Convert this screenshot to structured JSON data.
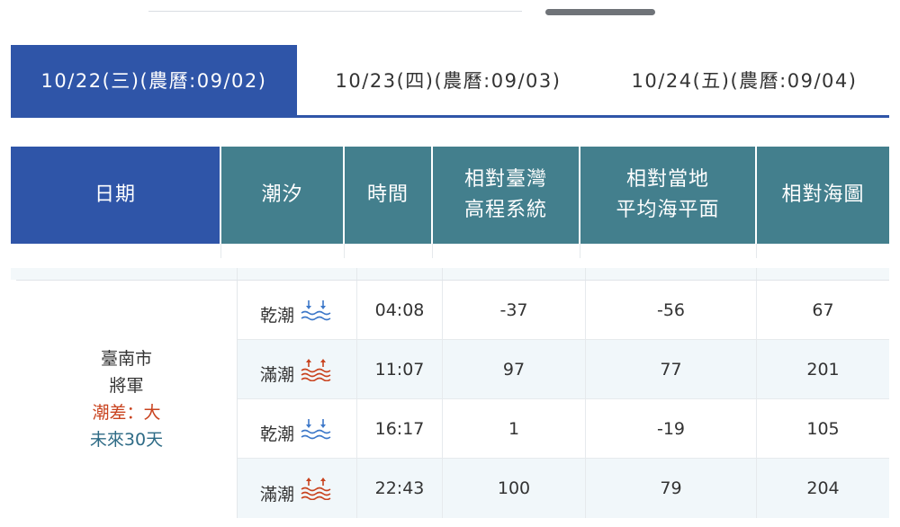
{
  "tabs": [
    {
      "label": "10/22(三)(農曆:09/02)",
      "active": true
    },
    {
      "label": "10/23(四)(農曆:09/03)",
      "active": false
    },
    {
      "label": "10/24(五)(農曆:09/04)",
      "active": false
    }
  ],
  "table": {
    "headers": {
      "date": "日期",
      "tide": "潮汐",
      "time": "時間",
      "twvd_line1": "相對臺灣",
      "twvd_line2": "高程系統",
      "msl_line1": "相對當地",
      "msl_line2": "平均海平面",
      "chart_datum": "相對海圖"
    },
    "location": {
      "city": "臺南市",
      "station": "將軍",
      "tide_range": "潮差：大",
      "forecast": "未來30天"
    },
    "rows": [
      {
        "tide": "乾潮",
        "icon": "low-tide-icon",
        "time": "04:08",
        "twvd": "-37",
        "msl": "-56",
        "chart_datum": "67"
      },
      {
        "tide": "滿潮",
        "icon": "high-tide-icon",
        "time": "11:07",
        "twvd": "97",
        "msl": "77",
        "chart_datum": "201"
      },
      {
        "tide": "乾潮",
        "icon": "low-tide-icon",
        "time": "16:17",
        "twvd": "1",
        "msl": "-19",
        "chart_datum": "105"
      },
      {
        "tide": "滿潮",
        "icon": "high-tide-icon",
        "time": "22:43",
        "twvd": "100",
        "msl": "79",
        "chart_datum": "204"
      }
    ]
  },
  "colors": {
    "accent_blue": "#2f55a8",
    "header_teal": "#437f8d",
    "low_tide_blue": "#3d78c9",
    "high_tide_red": "#c9431f"
  }
}
